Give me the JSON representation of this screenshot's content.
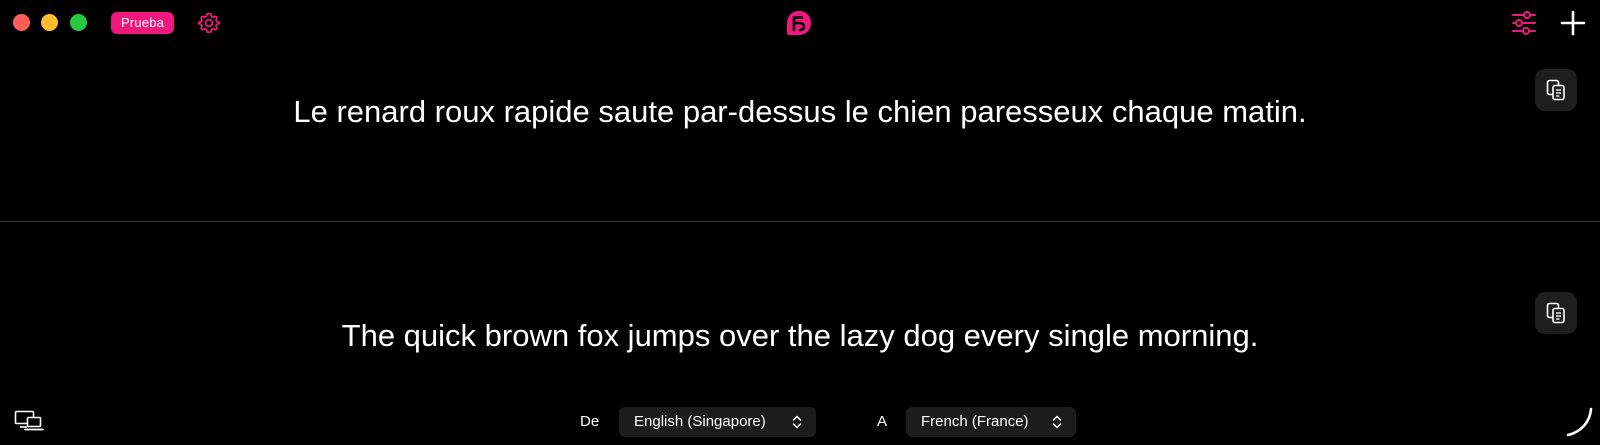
{
  "window": {
    "badge_label": "Prueba"
  },
  "colors": {
    "accent": "#f0187c",
    "background": "#000000",
    "text": "#ffffff",
    "control_bg": "#1c1c1c",
    "close": "#ff5f57",
    "minimize": "#febc2e",
    "maximize": "#28c840"
  },
  "icons": {
    "settings": "gear-icon",
    "logo": "app-logo-icon",
    "filters": "sliders-icon",
    "add": "plus-icon",
    "copy": "copy-icon",
    "devices": "devices-icon",
    "corner": "arc-icon"
  },
  "panes": {
    "top": {
      "text": "Le renard roux rapide saute par-dessus le chien paresseux chaque matin."
    },
    "bottom": {
      "text": "The quick brown fox jumps over the lazy dog every single morning."
    }
  },
  "languages": {
    "from_label": "De",
    "from_value": "English (Singapore)",
    "to_label": "A",
    "to_value": "French (France)"
  }
}
